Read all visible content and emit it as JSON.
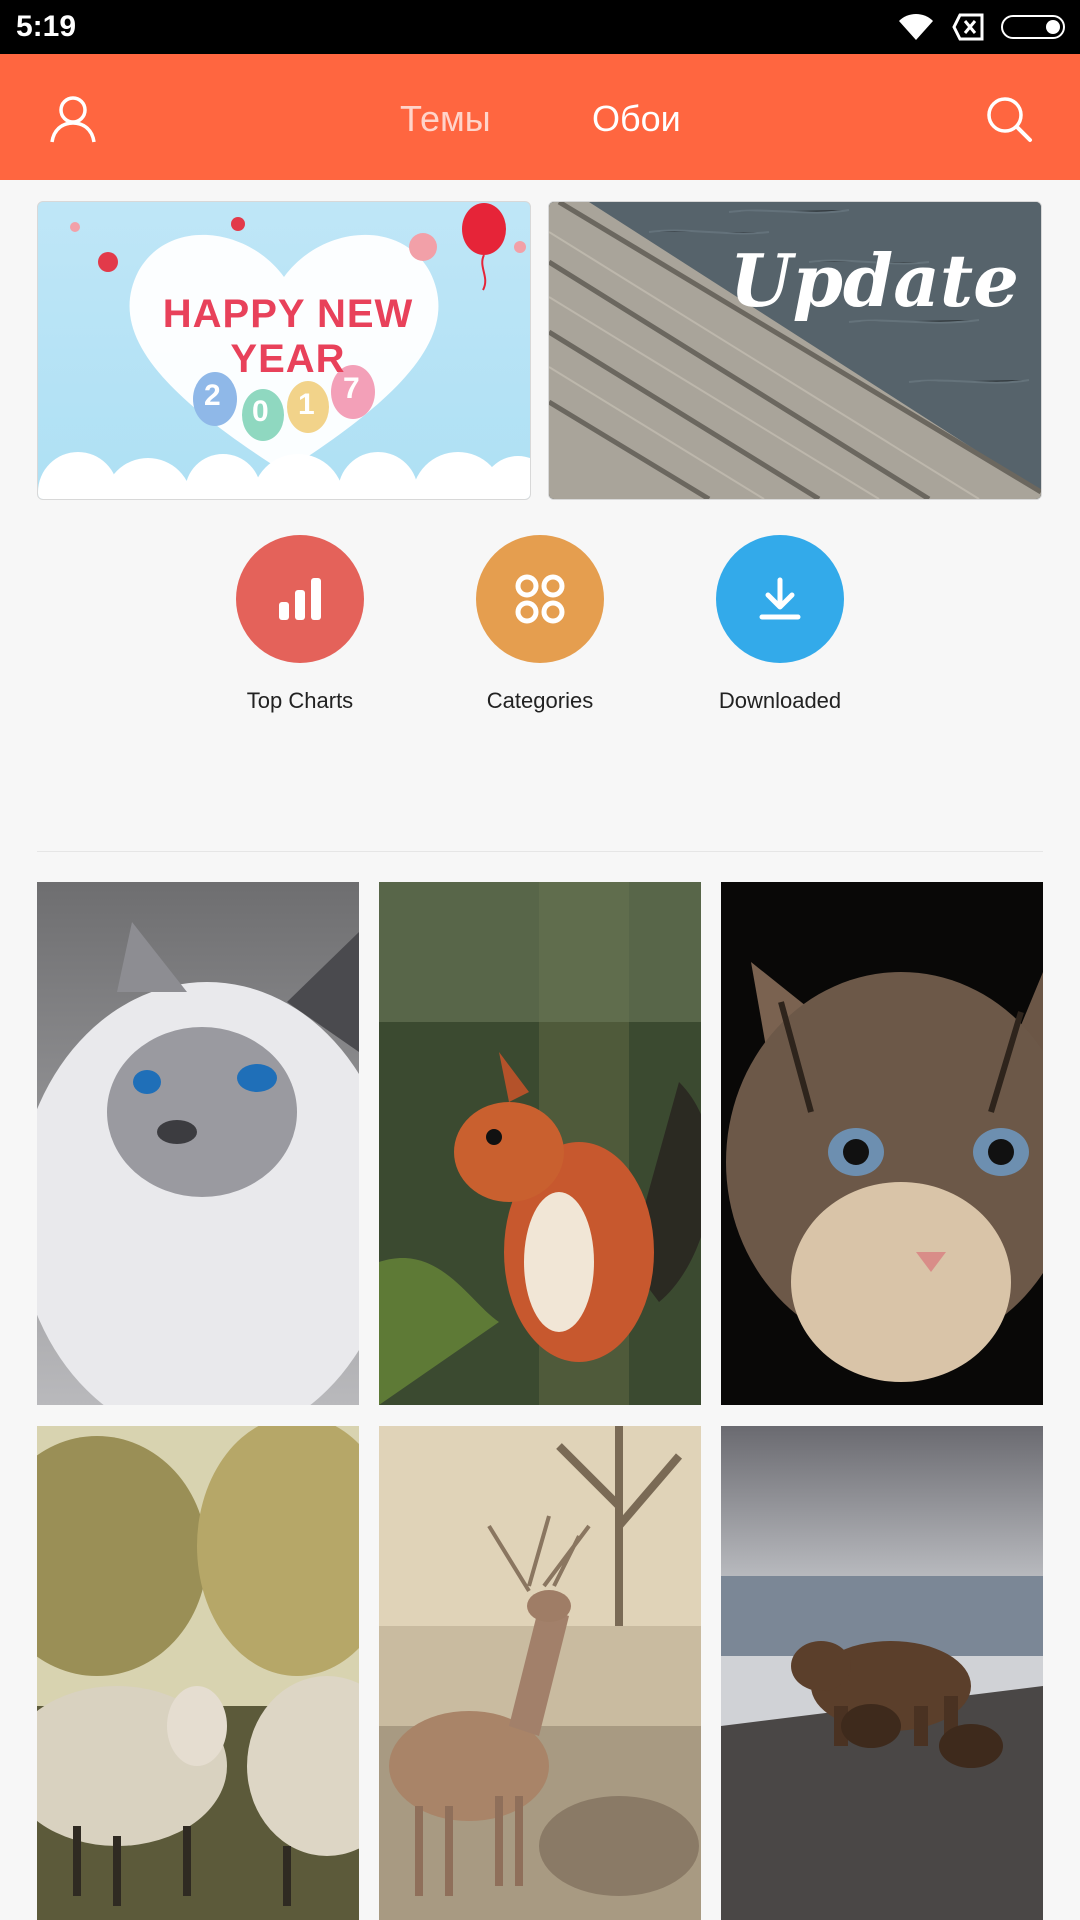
{
  "status_bar": {
    "time": "5:19"
  },
  "app_bar": {
    "tabs": [
      {
        "label": "Темы",
        "active": false
      },
      {
        "label": "Обои",
        "active": true
      }
    ],
    "accent_color": "#ff6640"
  },
  "banners": [
    {
      "id": "new-year",
      "title": "HAPPY NEW YEAR",
      "digits": [
        "2",
        "0",
        "1",
        "7"
      ]
    },
    {
      "id": "update",
      "title": "Update"
    }
  ],
  "quick_actions": [
    {
      "label": "Top Charts",
      "color": "#e4625a",
      "icon": "bar-chart-icon"
    },
    {
      "label": "Categories",
      "color": "#e59e4f",
      "icon": "grid-circles-icon"
    },
    {
      "label": "Downloaded",
      "color": "#33aaea",
      "icon": "download-icon"
    }
  ],
  "wallpapers": [
    {
      "subject": "white-cat"
    },
    {
      "subject": "squirrel"
    },
    {
      "subject": "tabby-cat"
    },
    {
      "subject": "sheep"
    },
    {
      "subject": "deer"
    },
    {
      "subject": "bear"
    }
  ]
}
